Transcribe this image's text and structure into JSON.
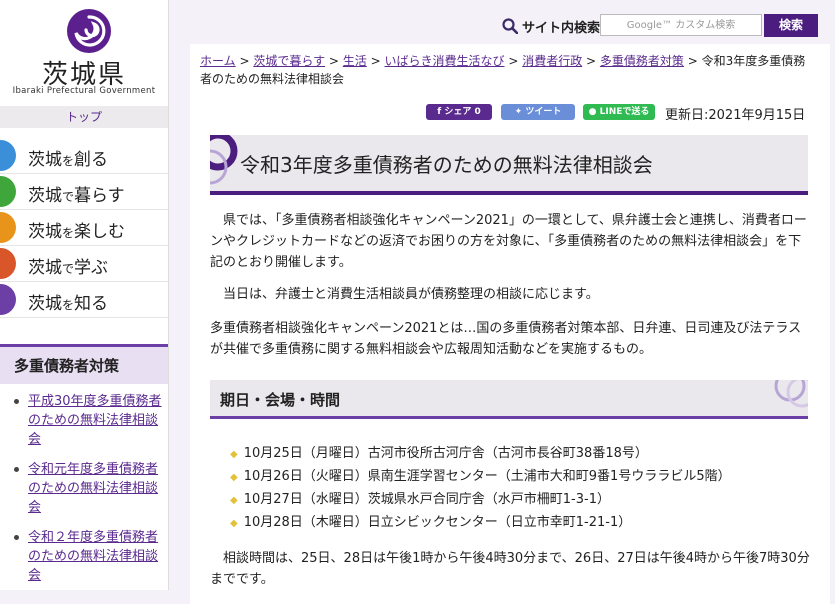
{
  "sidebar": {
    "pref_name": "茨城県",
    "pref_en": "Ibaraki Prefectural Government",
    "top_link": "トップ",
    "nav": [
      {
        "big": "茨城",
        "small": "を",
        "big2": "創る",
        "color": "#3a8fd8"
      },
      {
        "big": "茨城",
        "small": "で",
        "big2": "暮らす",
        "color": "#3ea63a"
      },
      {
        "big": "茨城",
        "small": "を",
        "big2": "楽しむ",
        "color": "#e8941a"
      },
      {
        "big": "茨城",
        "small": "で",
        "big2": "学ぶ",
        "color": "#d9552a"
      },
      {
        "big": "茨城",
        "small": "を",
        "big2": "知る",
        "color": "#6b3fa6"
      }
    ],
    "section_title": "多重債務者対策",
    "links": [
      "平成30年度多重債務者のための無料法律相談会",
      "令和元年度多重債務者のための無料法律相談会",
      "令和２年度多重債務者のための無料法律相談会"
    ]
  },
  "header": {
    "search_label": "サイト内検索",
    "search_placeholder": "Google™ カスタム検索",
    "search_button": "検索"
  },
  "breadcrumb": {
    "links": [
      "ホーム",
      "茨城で暮らす",
      "生活",
      "いばらき消費生活なび",
      "消費者行政",
      "多重債務者対策"
    ],
    "current": "令和3年度多重債務者のための無料法律相談会"
  },
  "share": {
    "facebook": "シェア 0",
    "twitter": "ツイート",
    "line": "LINEで送る",
    "colors": {
      "facebook": "#4267b2",
      "twitter": "#1da1f2",
      "line": "#06c755"
    }
  },
  "updated": "更新日:2021年9月15日",
  "page_title": "令和3年度多重債務者のための無料法律相談会",
  "paragraphs": [
    "県では、「多重債務者相談強化キャンペーン2021」の一環として、県弁護士会と連携し、消費者ローンやクレジットカードなどの返済でお困りの方を対象に、「多重債務者のための無料法律相談会」を下記のとおり開催します。",
    "当日は、弁護士と消費生活相談員が債務整理の相談に応じます。",
    "多重債務者相談強化キャンペーン2021とは…国の多重債務者対策本部、日弁連、日司連及び法テラスが共催で多重債務に関する無料相談会や広報周知活動などを実施するもの。"
  ],
  "section_heading": "期日・会場・時間",
  "schedule": [
    "10月25日（月曜日）古河市役所古河庁舎（古河市長谷町38番18号）",
    "10月26日（火曜日）県南生涯学習センター（土浦市大和町9番1号ウララビル5階）",
    "10月27日（水曜日）茨城県水戸合同庁舎（水戸市柵町1-3-1）",
    "10月28日（木曜日）日立シビックセンター（日立市幸町1-21-1）"
  ],
  "hours_text": "相談時間は、25日、28日は午後1時から午後4時30分まで、26日、27日は午後4時から午後7時30分までです。",
  "colors": {
    "accent": "#4b1d7f",
    "link": "#5a2a8e"
  }
}
